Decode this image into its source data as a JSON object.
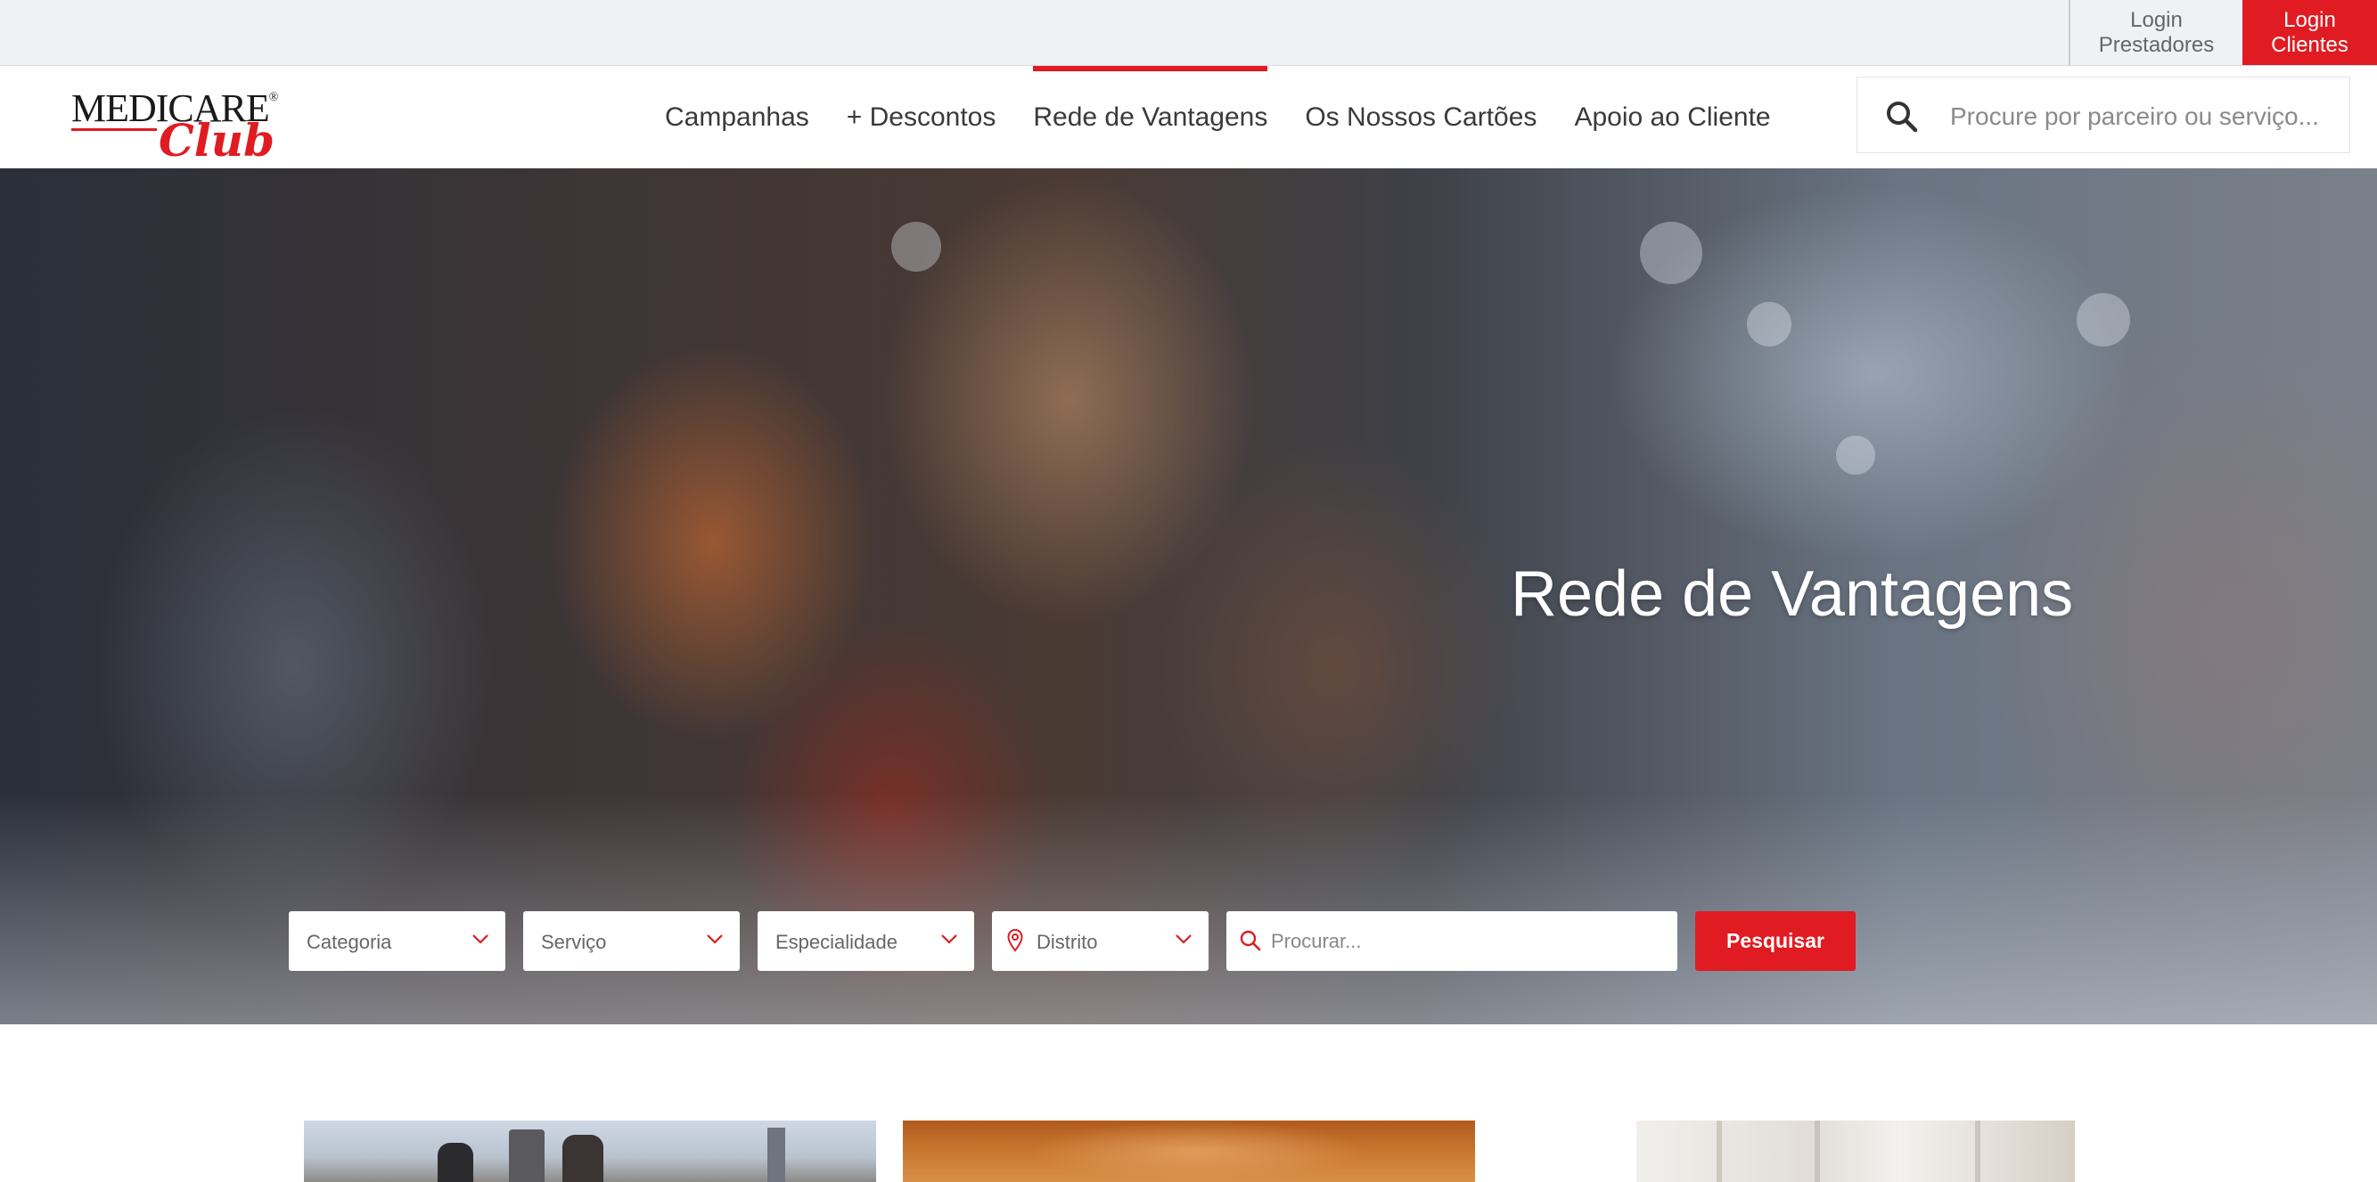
{
  "topbar": {
    "login_prestadores": [
      "Login",
      "Prestadores"
    ],
    "login_clientes": [
      "Login",
      "Clientes"
    ]
  },
  "logo": {
    "word1": "MEDICARE",
    "registered": "®",
    "word2": "Club"
  },
  "nav": {
    "items": [
      {
        "label": "Campanhas",
        "active": false
      },
      {
        "label": "+ Descontos",
        "active": false
      },
      {
        "label": "Rede de Vantagens",
        "active": true
      },
      {
        "label": "Os Nossos Cartões",
        "active": false
      },
      {
        "label": "Apoio ao Cliente",
        "active": false
      }
    ]
  },
  "header_search": {
    "placeholder": "Procure por parceiro ou serviço...",
    "icon": "search-icon"
  },
  "hero": {
    "title": "Rede de Vantagens",
    "filters": {
      "categoria": "Categoria",
      "servico": "Serviço",
      "especialidade": "Especialidade",
      "distrito": "Distrito",
      "procurar_placeholder": "Procurar..."
    },
    "search_button": "Pesquisar"
  },
  "colors": {
    "brand_red": "#e01b22",
    "topbar_bg": "#f0f1f4",
    "nav_text": "#3a3a3a"
  }
}
